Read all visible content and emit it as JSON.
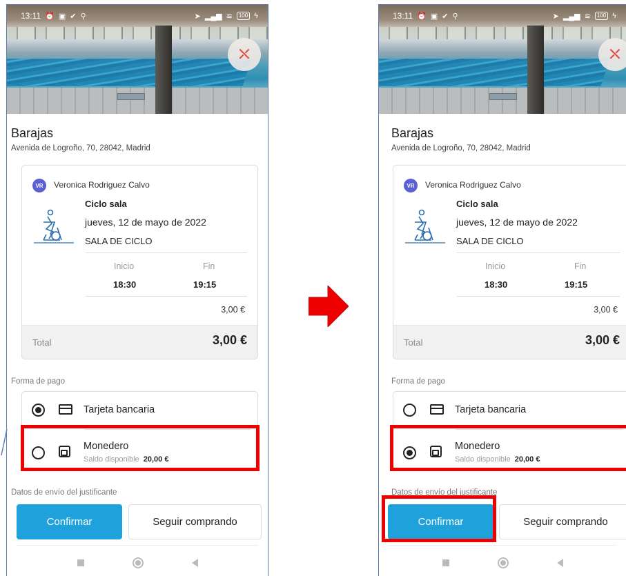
{
  "colors": {
    "accent": "#1fa2dc",
    "highlight": "#ee0000",
    "arrow": "#ee0000",
    "avatar": "#5a5fd6"
  },
  "screens": [
    {
      "id": "before",
      "status": {
        "time": "13:11",
        "battery": "100"
      },
      "gym": {
        "name": "Barajas",
        "address": "Avenida de Logroño, 70, 28042, Madrid"
      },
      "booking": {
        "avatar_initials": "VR",
        "instructor": "Veronica Rodriguez Calvo",
        "class_name": "Ciclo sala",
        "date": "jueves, 12 de mayo de 2022",
        "room": "SALA DE CICLO",
        "start_label": "Inicio",
        "end_label": "Fin",
        "start_time": "18:30",
        "end_time": "19:15",
        "price": "3,00 €",
        "total_label": "Total",
        "total_value": "3,00 €"
      },
      "payment": {
        "section_label": "Forma de pago",
        "card_option": "Tarjeta bancaria",
        "wallet_option": "Monedero",
        "balance_label": "Saldo disponible",
        "balance_value": "20,00 €",
        "selected": "card"
      },
      "receipt_label": "Datos de envío del justificante",
      "buttons": {
        "confirm": "Confirmar",
        "continue": "Seguir comprando"
      }
    },
    {
      "id": "after",
      "status": {
        "time": "13:11",
        "battery": "100"
      },
      "gym": {
        "name": "Barajas",
        "address": "Avenida de Logroño, 70, 28042, Madrid"
      },
      "booking": {
        "avatar_initials": "VR",
        "instructor": "Veronica Rodriguez Calvo",
        "class_name": "Ciclo sala",
        "date": "jueves, 12 de mayo de 2022",
        "room": "SALA DE CICLO",
        "start_label": "Inicio",
        "end_label": "Fin",
        "start_time": "18:30",
        "end_time": "19:15",
        "price": "3,00 €",
        "total_label": "Total",
        "total_value": "3,00 €"
      },
      "payment": {
        "section_label": "Forma de pago",
        "card_option": "Tarjeta bancaria",
        "wallet_option": "Monedero",
        "balance_label": "Saldo disponible",
        "balance_value": "20,00 €",
        "selected": "wallet"
      },
      "receipt_label": "Datos de envío del justificante",
      "buttons": {
        "confirm": "Confirmar",
        "continue": "Seguir comprando"
      }
    }
  ]
}
